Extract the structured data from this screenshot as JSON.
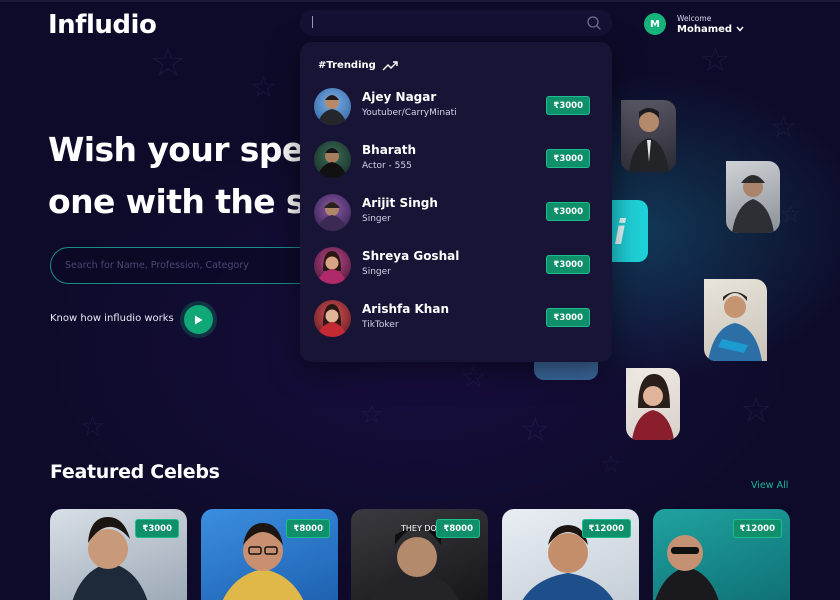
{
  "brand": "Infludio",
  "search": {
    "icon": "search-icon"
  },
  "user": {
    "initial": "M",
    "welcome": "Welcome",
    "name": "Mohamed"
  },
  "hero": {
    "line1": "Wish your spec",
    "line2": "one with the st",
    "search_placeholder": "Search for Name, Profession, Category",
    "how_label": "Know how infludio works"
  },
  "dropdown": {
    "heading": "#Trending",
    "items": [
      {
        "name": "Ajey Nagar",
        "role": "Youtuber/CarryMinati",
        "price": "₹3000"
      },
      {
        "name": "Bharath",
        "role": "Actor - 555",
        "price": "₹3000"
      },
      {
        "name": "Arijit Singh",
        "role": "Singer",
        "price": "₹3000"
      },
      {
        "name": "Shreya Goshal",
        "role": "Singer",
        "price": "₹3000"
      },
      {
        "name": "Arishfa Khan",
        "role": "TikToker",
        "price": "₹3000"
      }
    ]
  },
  "featured": {
    "title": "Featured Celebs",
    "view_all": "View All",
    "cards": [
      {
        "price": "₹3000"
      },
      {
        "price": "₹8000"
      },
      {
        "price": "₹8000"
      },
      {
        "price": "₹12000"
      },
      {
        "price": "₹12000"
      }
    ]
  },
  "colors": {
    "background": "#0e0b2a",
    "accent": "#11a878",
    "panel": "#181436"
  }
}
